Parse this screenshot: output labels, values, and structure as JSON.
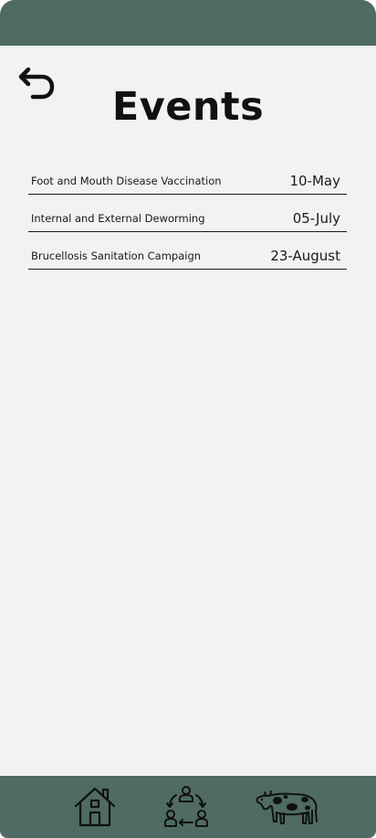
{
  "header": {
    "title": "Events",
    "back_icon": "back-arrow-icon"
  },
  "events": [
    {
      "name": "Foot and Mouth Disease Vaccination",
      "date": "10-May"
    },
    {
      "name": "Internal and External Deworming",
      "date": "05-July"
    },
    {
      "name": "Brucellosis Sanitation Campaign",
      "date": "23-August"
    }
  ],
  "bottom_nav": {
    "items": [
      {
        "icon": "home-icon"
      },
      {
        "icon": "community-icon"
      },
      {
        "icon": "cow-icon"
      }
    ]
  },
  "colors": {
    "bar": "#4f6b63",
    "background": "#f2f2f2",
    "text": "#111111"
  }
}
